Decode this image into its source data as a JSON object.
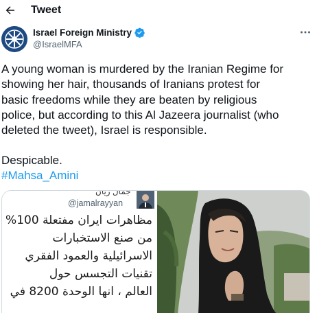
{
  "header": {
    "back_icon": "back-arrow-icon",
    "title": "Tweet"
  },
  "author": {
    "name": "Israel Foreign Ministry",
    "handle": "@IsraelMFA",
    "verified_icon": "verified-badge-icon",
    "verified_color": "#1d9bf0",
    "more_icon": "more-options-icon"
  },
  "tweet": {
    "lines": [
      "A young woman is murdered by the Iranian Regime for",
      "showing her hair, thousands of Iranians protest for",
      "basic freedoms while they are beaten by religious",
      "police, but according to this Al Jazeera journalist (who",
      "deleted the tweet), Israel is responsible."
    ],
    "sign_off": "Despicable.",
    "hashtag": "#Mahsa_Amini",
    "hashtag_color": "#1d9bf0"
  },
  "media": {
    "embedded_tweet": {
      "name": "جمال ريان",
      "handle": "@jamalrayyan",
      "lines": [
        "مظاهرات ايران مفتعلة 100%",
        "من صنع الاستخبارات",
        "الاسرائيلية والعمود الفقري",
        "تقنيات التجسس حول",
        "العالم ، انها الوحدة 8200 في"
      ]
    },
    "photo": "photo-of-woman-in-black-headscarf"
  }
}
